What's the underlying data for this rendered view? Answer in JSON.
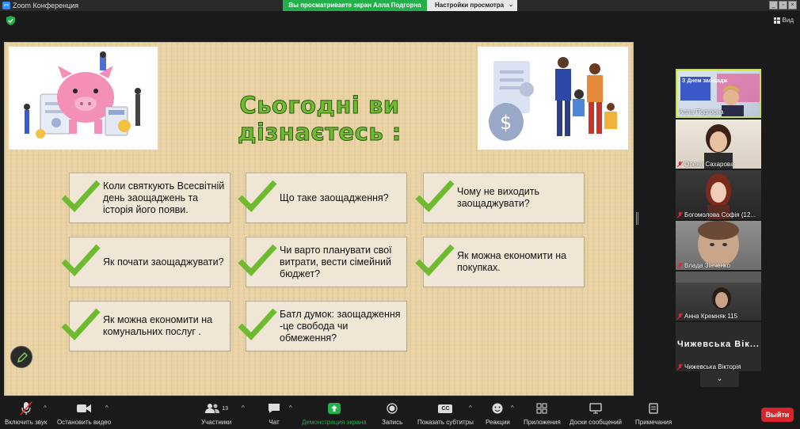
{
  "window": {
    "title": "Zoom Конференция",
    "logo_text": "zm",
    "share_banner": "Вы просматриваете экран Алла Подгорна",
    "view_settings": "Настройки просмотра"
  },
  "topbar": {
    "view_label": "Вид"
  },
  "slide": {
    "title": "Сьогодні ви дізнаєтесь :",
    "cards": [
      {
        "text": "Коли святкують Всесвітній день заощаджень та історія його появи."
      },
      {
        "text": "Що таке заощадження?"
      },
      {
        "text": "Чому не виходить заощаджувати?"
      },
      {
        "text": "Як почати заощаджувати?"
      },
      {
        "text": "Чи варто планувати свої витрати, вести сімейний бюджет?"
      },
      {
        "text": "Як можна економити на покупках."
      },
      {
        "text": "Як можна економити на комунальних послуг ."
      },
      {
        "text": "Батл думок: заощадження -це свобода чи обмеження?"
      }
    ],
    "colors": {
      "title_fill": "#6fbb2f",
      "check": "#6fbb2f",
      "background": "#e9d2a4"
    }
  },
  "participants": [
    {
      "name": "Алла Подгорна",
      "active": true,
      "muted": false,
      "overlay": "З Днем заощадж"
    },
    {
      "name": "Олена Сахарова",
      "muted": true
    },
    {
      "name": "Богомолова Софія (12...",
      "muted": true
    },
    {
      "name": "Влада Зінченко",
      "muted": true
    },
    {
      "name": "Анна Кремняк 115",
      "muted": true
    },
    {
      "name": "Чижевська Вікторія",
      "muted": true,
      "display_text": "Чижевська Вік..."
    }
  ],
  "toolbar": {
    "unmute": "Включить звук",
    "video": "Остановить видео",
    "participants": "Участники",
    "participants_count": "13",
    "chat": "Чат",
    "share": "Демонстрация экрана",
    "record": "Запись",
    "captions": "Показать субтитры",
    "captions_icon_text": "CC",
    "reactions": "Реакции",
    "apps": "Приложения",
    "whiteboards": "Доски сообщений",
    "notes": "Примечания",
    "leave": "Выйти"
  }
}
